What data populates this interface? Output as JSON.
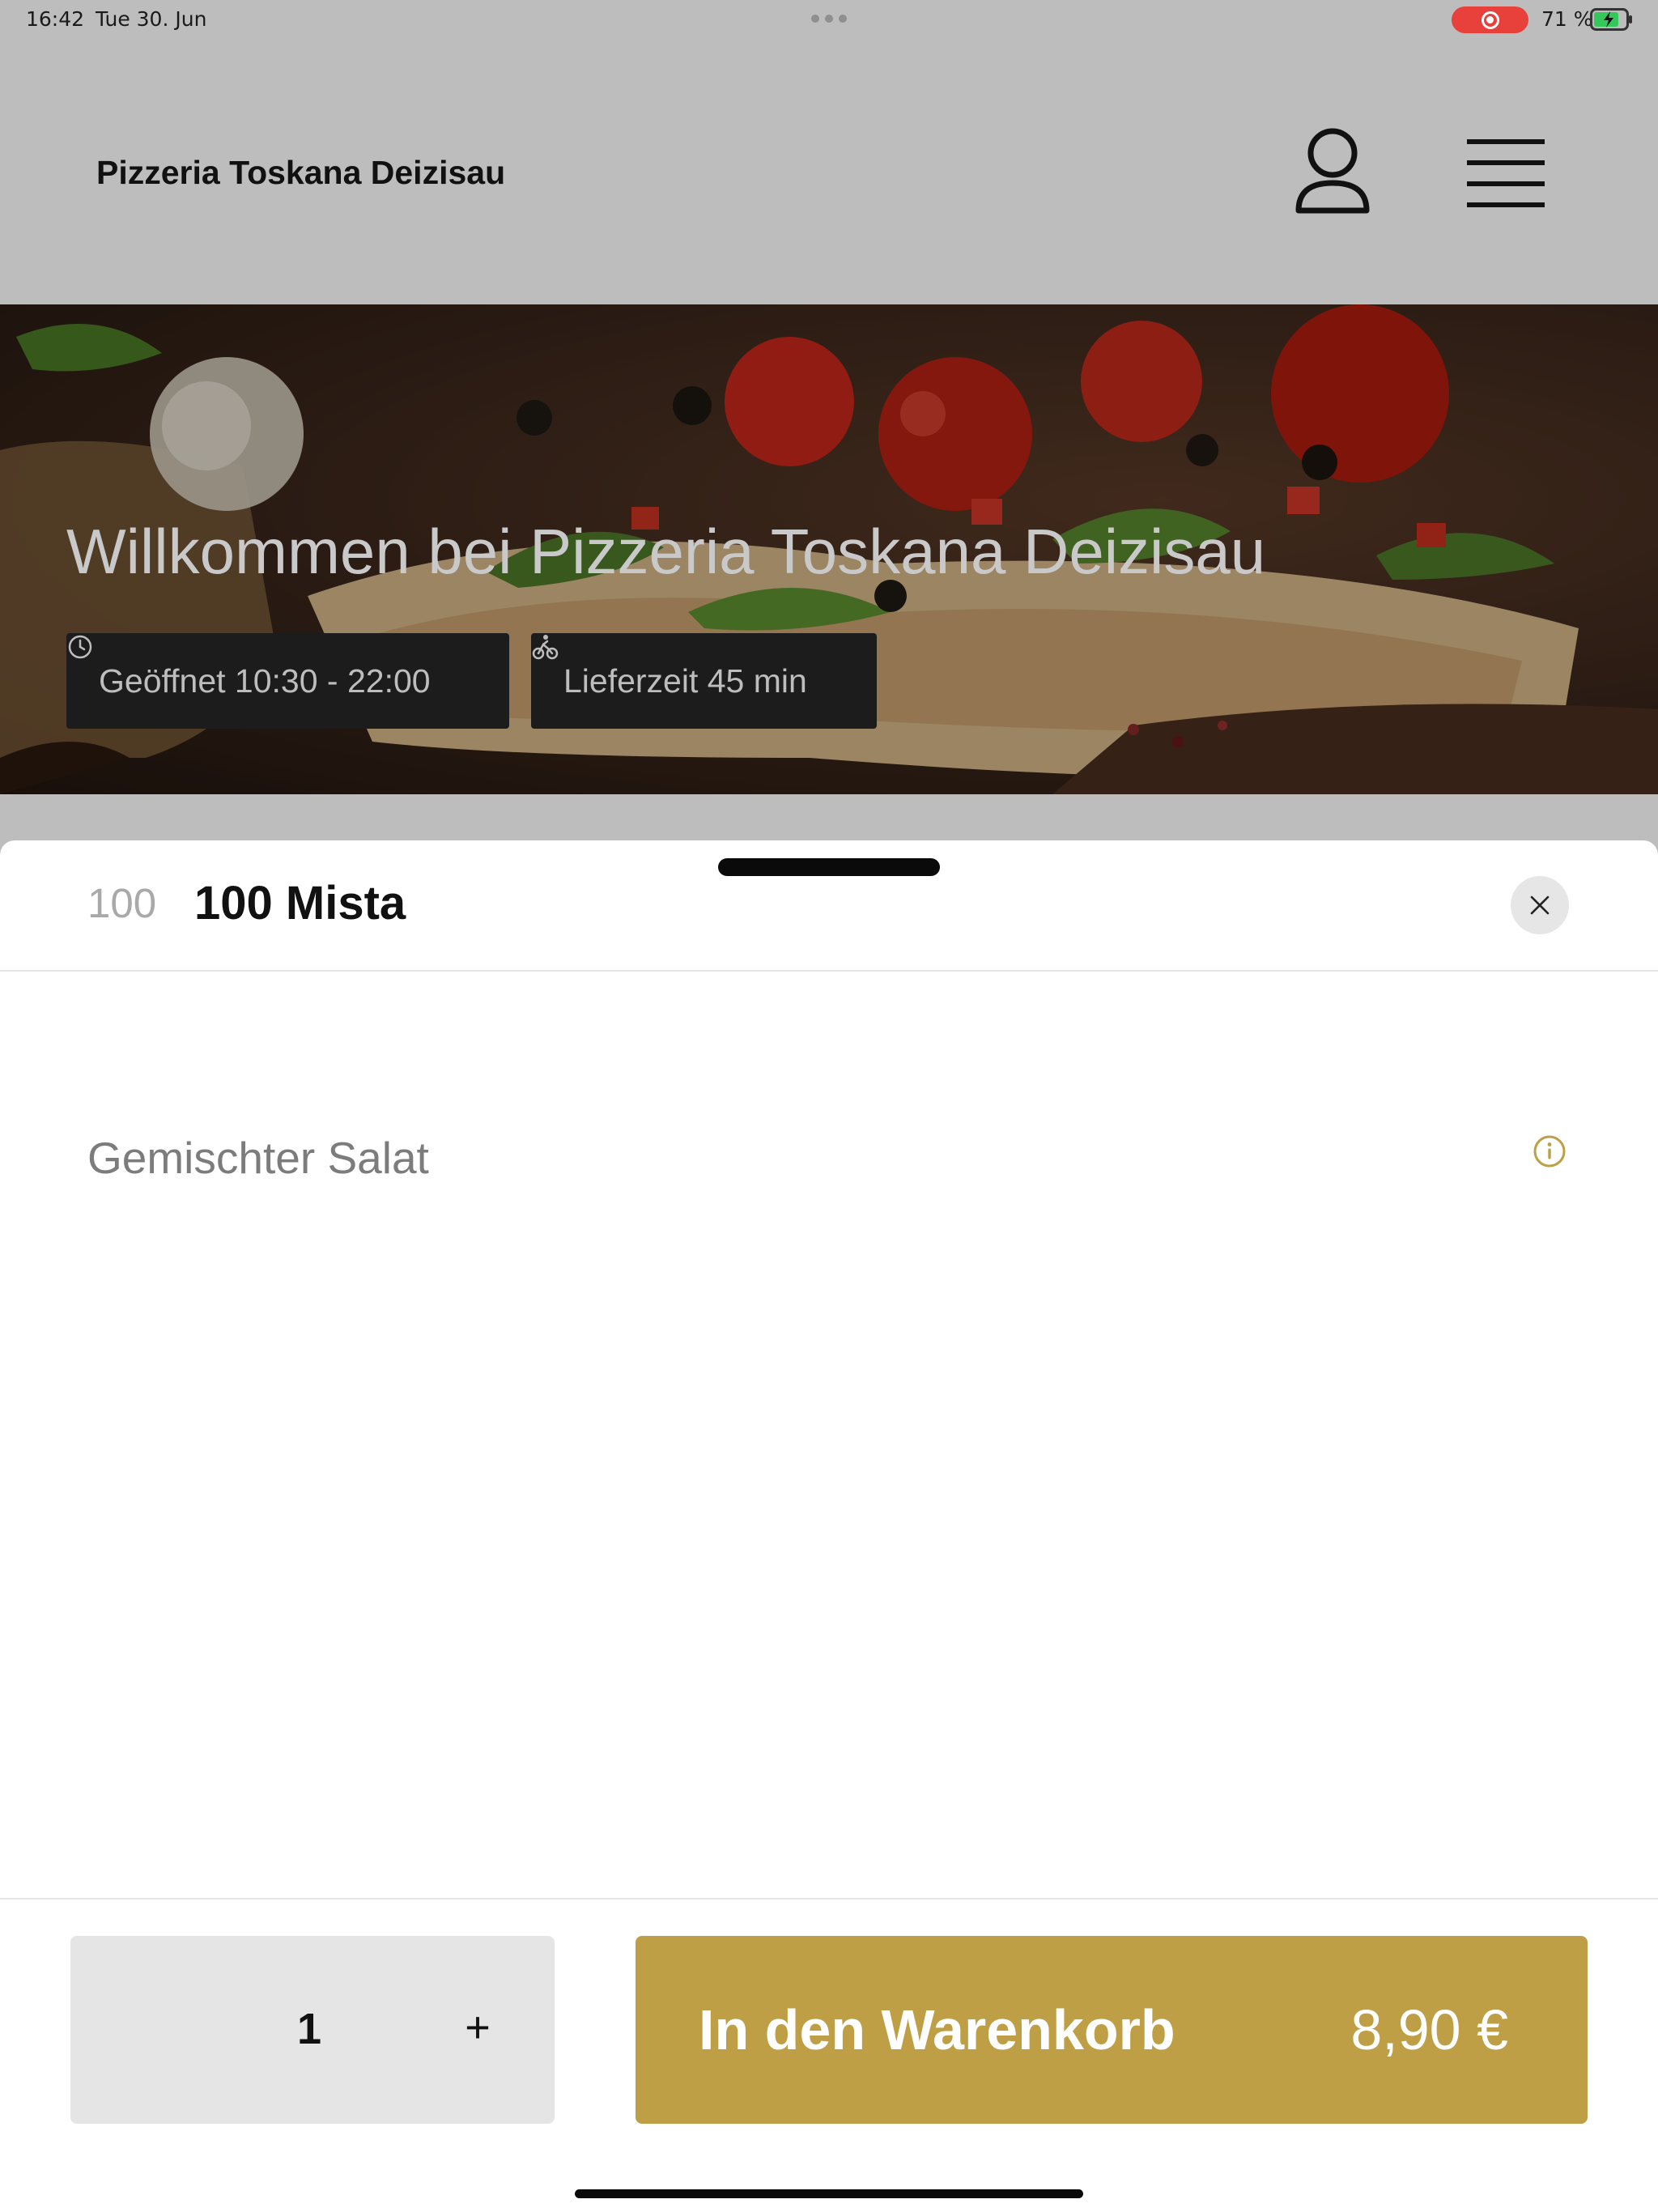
{
  "status_bar": {
    "time": "16:42",
    "date": "Tue 30. Jun",
    "battery": "71 %"
  },
  "header": {
    "title": "Pizzeria Toskana Deizisau",
    "icons": [
      "user-icon",
      "hamburger-menu-icon"
    ]
  },
  "hero": {
    "title": "Willkommen bei Pizzeria Toskana Deizisau",
    "opening_hours": "Geöffnet 10:30 - 22:00",
    "delivery_time": "Lieferzeit 45 min"
  },
  "sheet": {
    "item_number": "100",
    "item_title": "100 Mista",
    "description": "Gemischter Salat"
  },
  "footer": {
    "quantity": "1",
    "plus_label": "+",
    "add_label": "In den Warenkorb",
    "price": "8,90 €"
  },
  "colors": {
    "accent": "#bf9f45",
    "recording": "#e8403a",
    "battery_green": "#34c759"
  }
}
